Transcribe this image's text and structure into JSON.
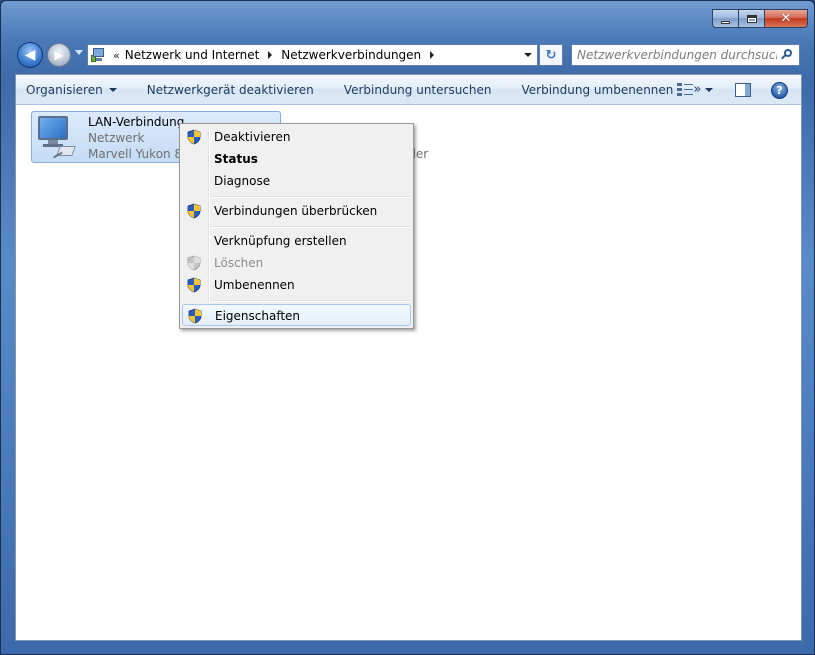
{
  "window": {
    "caption_buttons": {
      "minimize_icon": "minimize-icon",
      "maximize_icon": "maximize-icon",
      "close_glyph": "✕"
    }
  },
  "navigation": {
    "back_glyph": "◀",
    "forward_glyph": "▶",
    "breadcrumb": {
      "prefix": "«",
      "items": [
        "Netzwerk und Internet",
        "Netzwerkverbindungen"
      ]
    },
    "refresh_glyph": "↻",
    "search_placeholder": "Netzwerkverbindungen durchsuchen"
  },
  "toolbar": {
    "organize": "Organisieren",
    "disable_device": "Netzwerkgerät deaktivieren",
    "diagnose_connection": "Verbindung untersuchen",
    "rename_connection": "Verbindung umbenennen",
    "more": "»",
    "help_glyph": "?"
  },
  "connection": {
    "name": "LAN-Verbindung",
    "network": "Netzwerk",
    "adapter": "Marvell Yukon 88E8071 PCI-E Gigabit Ethernet Controller"
  },
  "context_menu": {
    "items": [
      {
        "label": "Deaktivieren",
        "shield": true
      },
      {
        "label": "Status",
        "bold": true
      },
      {
        "label": "Diagnose"
      },
      {
        "label": "Verbindungen überbrücken",
        "shield": true
      },
      {
        "label": "Verknüpfung erstellen"
      },
      {
        "label": "Löschen",
        "shield": true,
        "disabled": true
      },
      {
        "label": "Umbenennen",
        "shield": true
      },
      {
        "label": "Eigenschaften",
        "shield": true,
        "highlighted": true
      }
    ]
  },
  "colors": {
    "frame": "#4a79b8",
    "toolbar_text": "#1e395b",
    "selection": "#c4dcf5",
    "menu_background": "#f0f0f0",
    "disabled_text": "#8d8d8d"
  }
}
